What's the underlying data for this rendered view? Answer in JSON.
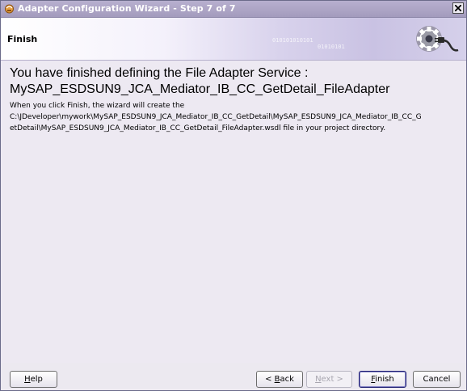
{
  "window": {
    "title": "Adapter Configuration Wizard - Step 7 of 7"
  },
  "banner": {
    "title": "Finish",
    "binary_text_1": "010101010101",
    "binary_text_2": "01010101",
    "icon": "gear-plug-icon"
  },
  "content": {
    "heading_line1": "You have finished defining the File Adapter Service :",
    "heading_line2": "MySAP_ESDSUN9_JCA_Mediator_IB_CC_GetDetail_FileAdapter",
    "desc_line1": "When you click Finish, the wizard will create the",
    "desc_line2": "C:\\JDeveloper\\mywork\\MySAP_ESDSUN9_JCA_Mediator_IB_CC_GetDetail\\MySAP_ESDSUN9_JCA_Mediator_IB_CC_G",
    "desc_line3": "etDetail\\MySAP_ESDSUN9_JCA_Mediator_IB_CC_GetDetail_FileAdapter.wsdl file in your project directory."
  },
  "buttons": {
    "help_mn": "H",
    "help_rest": "elp",
    "back_pre": "< ",
    "back_mn": "B",
    "back_rest": "ack",
    "next_mn": "N",
    "next_rest": "ext >",
    "finish_mn": "F",
    "finish_rest": "inish",
    "cancel": "Cancel"
  }
}
